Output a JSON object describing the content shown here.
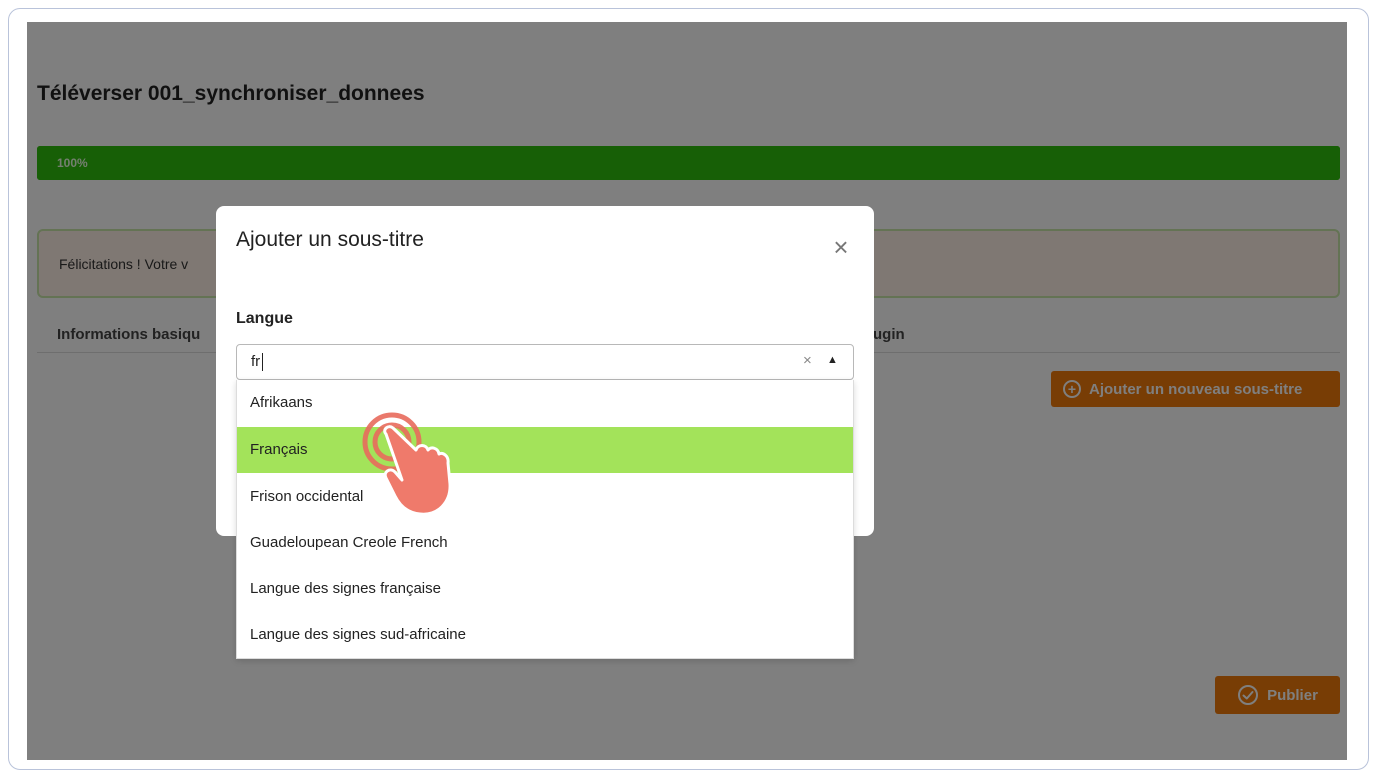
{
  "page": {
    "title": "Téléverser 001_synchroniser_donnees",
    "progress": {
      "label": "100%",
      "percent": 100
    },
    "alert_text": "Félicitations ! Votre v",
    "tabs": [
      "Informations basiqu",
      "ugin"
    ],
    "add_subtitle_label": "Ajouter un nouveau sous-titre",
    "publish_label": "Publier"
  },
  "modal": {
    "title": "Ajouter un sous-titre",
    "close": "×",
    "field_label": "Langue",
    "input_value": "fr",
    "clear": "×",
    "arrow": "▲",
    "options": [
      {
        "label": "Afrikaans",
        "selected": false
      },
      {
        "label": "Français",
        "selected": true
      },
      {
        "label": "Frison occidental",
        "selected": false
      },
      {
        "label": "Guadeloupean Creole French",
        "selected": false
      },
      {
        "label": "Langue des signes française",
        "selected": false
      },
      {
        "label": "Langue des signes sud-africaine",
        "selected": false
      }
    ]
  },
  "colors": {
    "accent_orange": "#f07a0a",
    "progress_green": "#2fbe0c",
    "highlight_green": "#a3e35a",
    "hand_cursor": "#e86a5c"
  },
  "icons": {
    "add": "plus-circle-icon",
    "publish": "check-circle-icon",
    "cursor": "tap-hand-cursor-icon"
  }
}
